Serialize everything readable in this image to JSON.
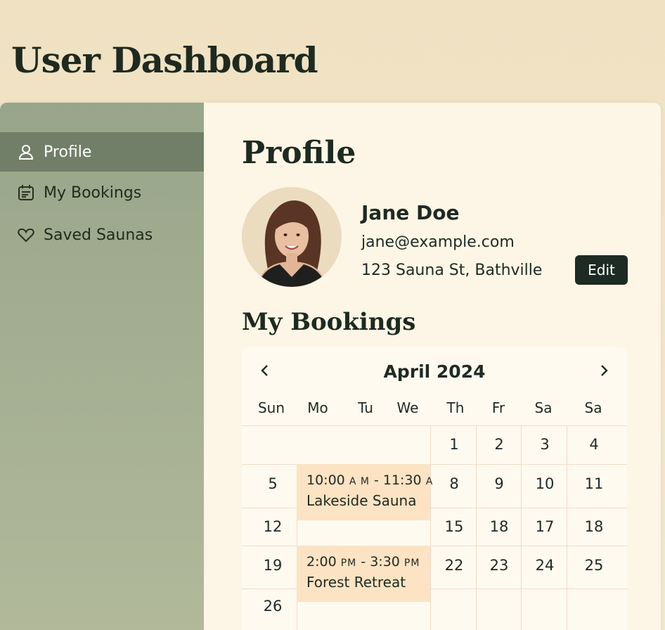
{
  "header": {
    "title": "User Dashboard"
  },
  "sidebar": {
    "items": [
      {
        "label": "Profile",
        "icon": "user-icon",
        "active": true
      },
      {
        "label": "My Bookings",
        "icon": "calendar-icon",
        "active": false
      },
      {
        "label": "Saved Saunas",
        "icon": "heart-icon",
        "active": false
      }
    ]
  },
  "profile": {
    "section_title": "Profile",
    "name": "Jane Doe",
    "email": "jane@example.com",
    "address": "123 Sauna St, Bathville",
    "edit_label": "Edit"
  },
  "bookings": {
    "section_title": "My Bookings",
    "calendar": {
      "month_label": "April 2024",
      "weekdays": [
        "Sun",
        "Mo",
        "Tu",
        "We",
        "Th",
        "Fr",
        "Sa",
        "Sa"
      ],
      "days": [
        "1",
        "2",
        "3",
        "4",
        "5",
        "8",
        "9",
        "10",
        "11",
        "12",
        "15",
        "18",
        "17",
        "18",
        "19",
        "22",
        "23",
        "24",
        "25",
        "26"
      ],
      "events": [
        {
          "time_start": "10:00",
          "ampm_start": "A M",
          "time_end": "11:30",
          "ampm_end": "A",
          "place": "Lakeside Sauna"
        },
        {
          "time_start": "2:00",
          "ampm_start": "PM",
          "time_end": "3:30",
          "ampm_end": "PM",
          "place": "Forest Retreat"
        }
      ]
    }
  },
  "colors": {
    "background": "#efe1c2",
    "sidebar": "#a7b092",
    "sidebar_active": "#717f68",
    "panel": "#fdf6e6",
    "button": "#1d2b24",
    "event": "#fbe3c3"
  }
}
